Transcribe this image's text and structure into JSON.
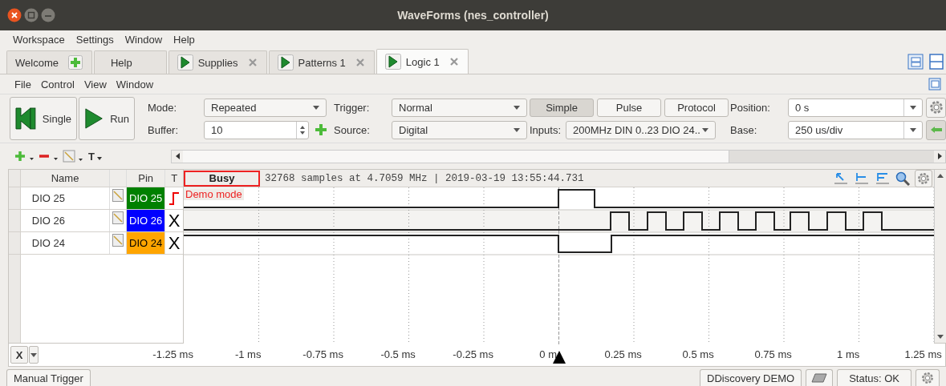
{
  "window": {
    "title": "WaveForms (nes_controller)"
  },
  "menu": [
    "Workspace",
    "Settings",
    "Window",
    "Help"
  ],
  "tabs": [
    {
      "label": "Welcome",
      "kind": "add",
      "selected": false
    },
    {
      "label": "Help",
      "kind": "plain",
      "selected": false
    },
    {
      "label": "Supplies",
      "kind": "run",
      "selected": false
    },
    {
      "label": "Patterns 1",
      "kind": "run",
      "selected": false
    },
    {
      "label": "Logic 1",
      "kind": "run",
      "selected": true
    }
  ],
  "submenu": [
    "File",
    "Control",
    "View",
    "Window"
  ],
  "toolbar": {
    "single": "Single",
    "run": "Run",
    "mode_label": "Mode:",
    "mode": "Repeated",
    "buffer_label": "Buffer:",
    "buffer": "10",
    "trigger_label": "Trigger:",
    "trigger": "Normal",
    "source_label": "Source:",
    "source": "Digital",
    "trigger_types": [
      {
        "label": "Simple",
        "selected": true
      },
      {
        "label": "Pulse",
        "selected": false
      },
      {
        "label": "Protocol",
        "selected": false
      }
    ],
    "inputs_label": "Inputs:",
    "inputs": "200MHz DIN 0..23 DIO 24..",
    "position_label": "Position:",
    "position": "0 s",
    "base_label": "Base:",
    "base": "250 us/div"
  },
  "channel_tools": {
    "text_tool": "T"
  },
  "table": {
    "columns": [
      "Name",
      "Pin",
      "T"
    ],
    "status": "Busy",
    "info": "32768 samples at 4.7059 MHz | 2019-03-19 13:55:44.731",
    "overlay": "Demo mode",
    "channels": [
      {
        "name": "DIO 25",
        "pin": "DIO 25",
        "color": "#008000",
        "trigger": {
          "kind": "rising"
        }
      },
      {
        "name": "DIO 26",
        "pin": "DIO 26",
        "color": "#0000ff",
        "trigger": {
          "kind": "text",
          "text": "X"
        }
      },
      {
        "name": "DIO 24",
        "pin": "DIO 24",
        "color": "#ffa500",
        "trigger": {
          "kind": "text",
          "text": "X"
        }
      }
    ]
  },
  "axis": {
    "button": "X",
    "labels": [
      "-1.25 ms",
      "-1 ms",
      "-0.75 ms",
      "-0.5 ms",
      "-0.25 ms",
      "0 m",
      "0.25 ms",
      "0.5 ms",
      "0.75 ms",
      "1 ms",
      "1.25 ms"
    ]
  },
  "status_bar": {
    "manual_trigger": "Manual Trigger",
    "device": "DDiscovery DEMO",
    "status": "Status: OK"
  }
}
